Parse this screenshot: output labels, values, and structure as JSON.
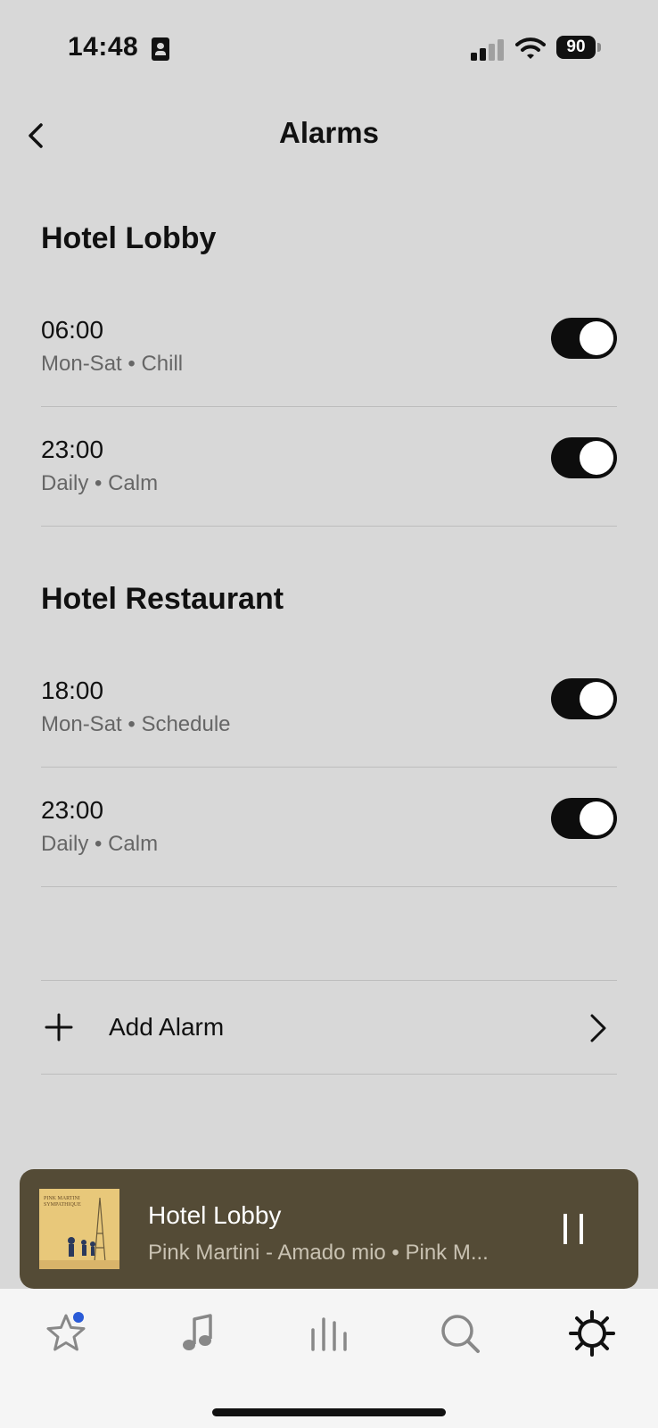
{
  "status_bar": {
    "time": "14:48",
    "battery": "90"
  },
  "header": {
    "title": "Alarms",
    "back_icon": "chevron-left-icon"
  },
  "sections": [
    {
      "title": "Hotel Lobby",
      "alarms": [
        {
          "time": "06:00",
          "detail": "Mon-Sat • Chill",
          "enabled": true
        },
        {
          "time": "23:00",
          "detail": "Daily • Calm",
          "enabled": true
        }
      ]
    },
    {
      "title": "Hotel Restaurant",
      "alarms": [
        {
          "time": "18:00",
          "detail": "Mon-Sat • Schedule",
          "enabled": true
        },
        {
          "time": "23:00",
          "detail": "Daily • Calm",
          "enabled": true
        }
      ]
    }
  ],
  "add_alarm": {
    "label": "Add Alarm",
    "icon": "plus-icon"
  },
  "now_playing": {
    "room": "Hotel Lobby",
    "track": "Pink Martini - Amado mio • Pink M...",
    "album_art_text": "PINK MARTINI SYMPATHIQUE",
    "state": "playing"
  },
  "tabs": [
    {
      "name": "favorites",
      "icon": "star-icon",
      "badge": true
    },
    {
      "name": "music",
      "icon": "music-note-icon"
    },
    {
      "name": "rooms",
      "icon": "bars-icon"
    },
    {
      "name": "search",
      "icon": "search-icon"
    },
    {
      "name": "settings",
      "icon": "gear-icon",
      "active": true
    }
  ],
  "colors": {
    "background": "#d8d8d8",
    "toggle_on": "#0d0d0d",
    "now_playing_bg": "#544b36",
    "badge": "#2a5bd7"
  }
}
